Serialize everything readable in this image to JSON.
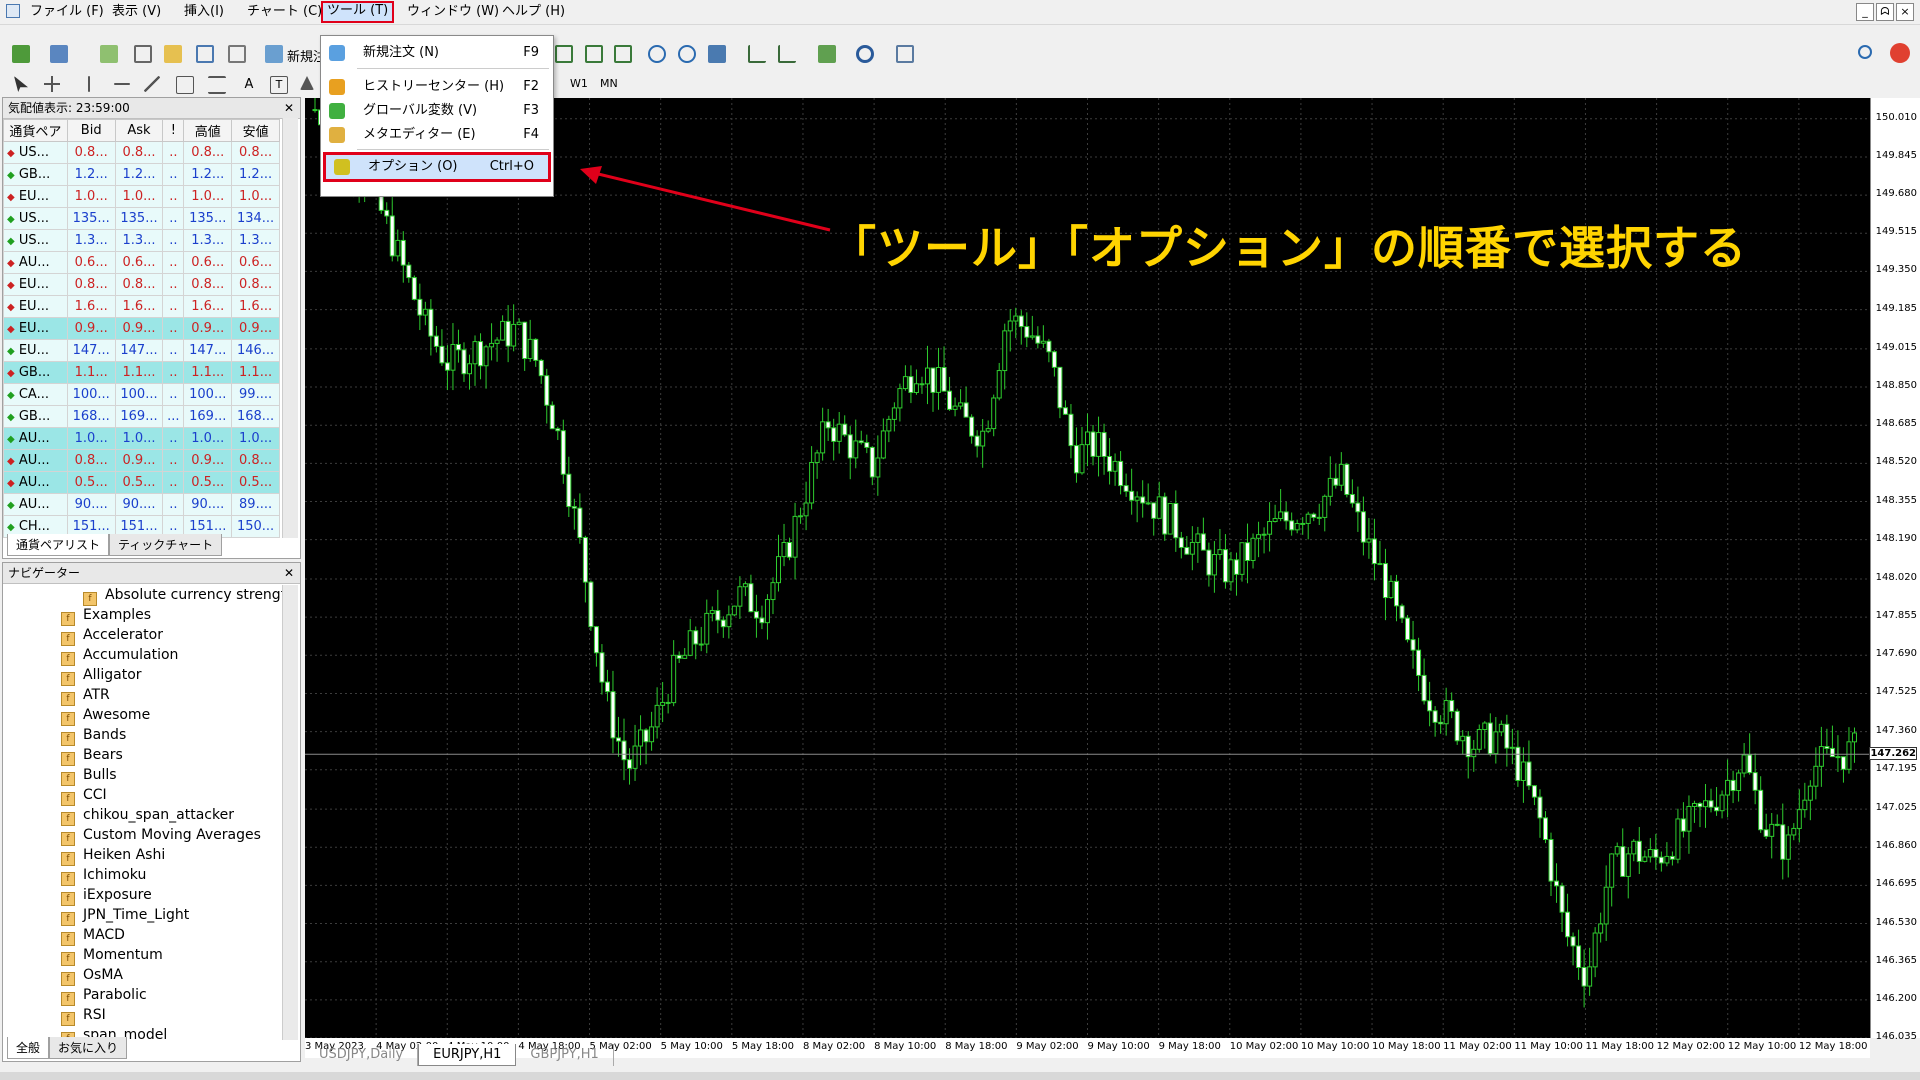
{
  "menubar": {
    "items": [
      "ファイル (F)",
      "表示 (V)",
      "挿入(I)",
      "チャート (C)",
      "ツール (T)",
      "ウィンドウ (W)",
      "ヘルプ (H)"
    ],
    "active_index": 4,
    "window_controls": [
      "_",
      "ᗣ",
      "×"
    ]
  },
  "toolbar": {
    "new_order_label": "新規注",
    "timeframes": [
      "W1",
      "MN"
    ]
  },
  "market_watch": {
    "title": "気配値表示: 23:59:00",
    "columns": [
      "通貨ペア",
      "Bid",
      "Ask",
      "!",
      "高値",
      "安値"
    ],
    "rows": [
      {
        "sym": "US...",
        "bid": "0.8...",
        "ask": "0.8...",
        "spr": "..",
        "high": "0.8...",
        "low": "0.8...",
        "dir": "down",
        "bg": "plain"
      },
      {
        "sym": "GB...",
        "bid": "1.2...",
        "ask": "1.2...",
        "spr": "..",
        "high": "1.2...",
        "low": "1.2...",
        "dir": "up",
        "bg": "plain"
      },
      {
        "sym": "EU...",
        "bid": "1.0...",
        "ask": "1.0...",
        "spr": "..",
        "high": "1.0...",
        "low": "1.0...",
        "dir": "down",
        "bg": "plain"
      },
      {
        "sym": "US...",
        "bid": "135...",
        "ask": "135...",
        "spr": "..",
        "high": "135...",
        "low": "134...",
        "dir": "up",
        "bg": "plain"
      },
      {
        "sym": "US...",
        "bid": "1.3...",
        "ask": "1.3...",
        "spr": "..",
        "high": "1.3...",
        "low": "1.3...",
        "dir": "up",
        "bg": "plain"
      },
      {
        "sym": "AU...",
        "bid": "0.6...",
        "ask": "0.6...",
        "spr": "..",
        "high": "0.6...",
        "low": "0.6...",
        "dir": "down",
        "bg": "plain"
      },
      {
        "sym": "EU...",
        "bid": "0.8...",
        "ask": "0.8...",
        "spr": "..",
        "high": "0.8...",
        "low": "0.8...",
        "dir": "down",
        "bg": "plain"
      },
      {
        "sym": "EU...",
        "bid": "1.6...",
        "ask": "1.6...",
        "spr": "..",
        "high": "1.6...",
        "low": "1.6...",
        "dir": "down",
        "bg": "plain"
      },
      {
        "sym": "EU...",
        "bid": "0.9...",
        "ask": "0.9...",
        "spr": "..",
        "high": "0.9...",
        "low": "0.9...",
        "dir": "down",
        "bg": "teal"
      },
      {
        "sym": "EU...",
        "bid": "147...",
        "ask": "147...",
        "spr": "..",
        "high": "147...",
        "low": "146...",
        "dir": "up",
        "bg": "plain"
      },
      {
        "sym": "GB...",
        "bid": "1.1...",
        "ask": "1.1...",
        "spr": "..",
        "high": "1.1...",
        "low": "1.1...",
        "dir": "down",
        "bg": "teal"
      },
      {
        "sym": "CA...",
        "bid": "100...",
        "ask": "100...",
        "spr": "..",
        "high": "100...",
        "low": "99....",
        "dir": "up",
        "bg": "plain"
      },
      {
        "sym": "GB...",
        "bid": "168...",
        "ask": "169...",
        "spr": "...",
        "high": "169...",
        "low": "168...",
        "dir": "up",
        "bg": "plain"
      },
      {
        "sym": "AU...",
        "bid": "1.0...",
        "ask": "1.0...",
        "spr": "..",
        "high": "1.0...",
        "low": "1.0...",
        "dir": "up",
        "bg": "teal"
      },
      {
        "sym": "AU...",
        "bid": "0.8...",
        "ask": "0.9...",
        "spr": "..",
        "high": "0.9...",
        "low": "0.8...",
        "dir": "down",
        "bg": "teal"
      },
      {
        "sym": "AU...",
        "bid": "0.5...",
        "ask": "0.5...",
        "spr": "..",
        "high": "0.5...",
        "low": "0.5...",
        "dir": "down",
        "bg": "teal"
      },
      {
        "sym": "AU...",
        "bid": "90....",
        "ask": "90....",
        "spr": "..",
        "high": "90....",
        "low": "89....",
        "dir": "up",
        "bg": "plain"
      },
      {
        "sym": "CH...",
        "bid": "151...",
        "ask": "151...",
        "spr": "..",
        "high": "151...",
        "low": "150...",
        "dir": "up",
        "bg": "plain"
      }
    ],
    "tabs": [
      "通貨ペアリスト",
      "ティックチャート"
    ]
  },
  "navigator": {
    "title": "ナビゲーター",
    "items": [
      "Absolute currency strength",
      "Examples",
      "Accelerator",
      "Accumulation",
      "Alligator",
      "ATR",
      "Awesome",
      "Bands",
      "Bears",
      "Bulls",
      "CCI",
      "chikou_span_attacker",
      "Custom Moving Averages",
      "Heiken Ashi",
      "Ichimoku",
      "iExposure",
      "JPN_Time_Light",
      "MACD",
      "Momentum",
      "OsMA",
      "Parabolic",
      "RSI",
      "span_model"
    ],
    "tabs": [
      "全般",
      "お気に入り"
    ]
  },
  "dropdown": {
    "items": [
      {
        "label": "新規注文 (N)",
        "key": "F9",
        "color": "#5aa0e0"
      },
      {
        "label": "ヒストリーセンター (H)",
        "key": "F2",
        "color": "#e8a020"
      },
      {
        "label": "グローバル変数 (V)",
        "key": "F3",
        "color": "#40b040"
      },
      {
        "label": "メタエディター (E)",
        "key": "F4",
        "color": "#e0b040"
      },
      {
        "label": "オプション (O)",
        "key": "Ctrl+O",
        "color": "#d0c020",
        "highlighted": true
      }
    ]
  },
  "annotation": {
    "text": "「ツール」「オプション」の順番で選択する",
    "color": "#ffd400"
  },
  "price_axis": [
    "150.010",
    "149.845",
    "149.680",
    "149.515",
    "149.350",
    "149.185",
    "149.015",
    "148.850",
    "148.685",
    "148.520",
    "148.355",
    "148.190",
    "148.020",
    "147.855",
    "147.690",
    "147.525",
    "147.360",
    "147.195",
    "147.025",
    "146.860",
    "146.695",
    "146.530",
    "146.365",
    "146.200",
    "146.035"
  ],
  "current_price": "147.262",
  "time_axis": [
    "3 May 2023",
    "4 May 02:00",
    "4 May 10:00",
    "4 May 18:00",
    "5 May 02:00",
    "5 May 10:00",
    "5 May 18:00",
    "8 May 02:00",
    "8 May 10:00",
    "8 May 18:00",
    "9 May 02:00",
    "9 May 10:00",
    "9 May 18:00",
    "10 May 02:00",
    "10 May 10:00",
    "10 May 18:00",
    "11 May 02:00",
    "11 May 10:00",
    "11 May 18:00",
    "12 May 02:00",
    "12 May 10:00",
    "12 May 18:00"
  ],
  "chart_tabs": [
    "USDJPY,Daily",
    "EURJPY,H1",
    "GBPJPY,H1"
  ],
  "chart_tab_selected": 1,
  "chart_data": {
    "type": "candlestick",
    "symbol": "EURJPY",
    "timeframe": "H1",
    "ylim": [
      146.035,
      150.1
    ],
    "current_price": 147.262,
    "close_path": [
      150.05,
      149.95,
      149.8,
      149.6,
      149.35,
      149.1,
      148.95,
      149.0,
      149.05,
      149.1,
      148.95,
      148.6,
      148.1,
      147.5,
      147.2,
      147.35,
      147.6,
      147.75,
      147.85,
      147.95,
      147.9,
      148.1,
      148.4,
      148.7,
      148.6,
      148.5,
      148.8,
      148.95,
      148.85,
      148.7,
      148.65,
      149.15,
      149.1,
      148.95,
      148.55,
      148.6,
      148.5,
      148.4,
      148.3,
      148.2,
      148.1,
      148.05,
      148.15,
      148.25,
      148.3,
      148.35,
      148.45,
      148.2,
      148.0,
      147.7,
      147.5,
      147.4,
      147.3,
      147.35,
      147.2,
      146.95,
      146.5,
      146.3,
      146.75,
      146.85,
      146.8,
      146.9,
      147.0,
      147.1,
      147.25,
      146.95,
      146.85,
      147.2,
      147.25,
      147.28
    ]
  }
}
